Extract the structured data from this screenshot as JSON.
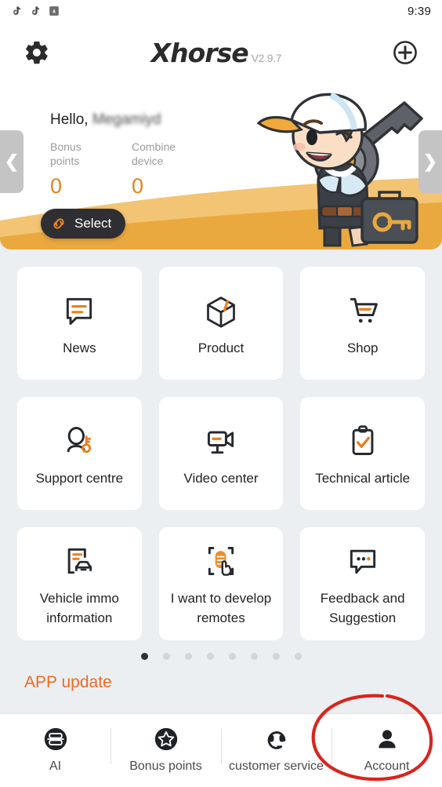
{
  "status_bar": {
    "time": "9:39",
    "icons": [
      "tiktok-icon",
      "tiktok-icon",
      "app-badge-icon"
    ]
  },
  "header": {
    "settings_icon": "gear-icon",
    "logo_text": "Xhorse",
    "version": "V2.9.7",
    "add_icon": "plus-circle-icon"
  },
  "hero": {
    "greeting_prefix": "Hello, ",
    "greeting_name": "Megamiyd",
    "stats": [
      {
        "label": "Bonus points",
        "value": "0"
      },
      {
        "label": "Combine device",
        "value": "0"
      }
    ],
    "select_label": "Select",
    "select_icon": "link-icon",
    "prev_arrow": "❮",
    "next_arrow": "❯",
    "mascot": "mascot-key-boy"
  },
  "grid": {
    "items": [
      {
        "label": "News",
        "icon": "news-bubble-icon"
      },
      {
        "label": "Product",
        "icon": "box-icon"
      },
      {
        "label": "Shop",
        "icon": "cart-icon"
      },
      {
        "label": "Support centre",
        "icon": "support-person-key-icon"
      },
      {
        "label": "Video center",
        "icon": "video-camera-icon"
      },
      {
        "label": "Technical article",
        "icon": "clipboard-check-icon"
      },
      {
        "label": "Vehicle immo information",
        "icon": "car-document-icon"
      },
      {
        "label": "I want to develop remotes",
        "icon": "remote-hand-icon"
      },
      {
        "label": "Feedback and Suggestion",
        "icon": "feedback-bubble-icon"
      }
    ]
  },
  "pager": {
    "count": 8,
    "active_index": 0
  },
  "app_update": {
    "label": "APP update"
  },
  "bottom_nav": {
    "items": [
      {
        "label": "AI",
        "icon": "ai-icon"
      },
      {
        "label": "Bonus points",
        "icon": "star-badge-icon"
      },
      {
        "label": "customer service",
        "icon": "headset-icon"
      },
      {
        "label": "Account",
        "icon": "person-icon"
      }
    ],
    "highlighted_index": 3
  },
  "colors": {
    "accent_orange": "#e8801e",
    "update_orange": "#ec6a22",
    "dark": "#2e2e33",
    "page_bg": "#eceff1",
    "annotation_red": "#d7261e"
  }
}
